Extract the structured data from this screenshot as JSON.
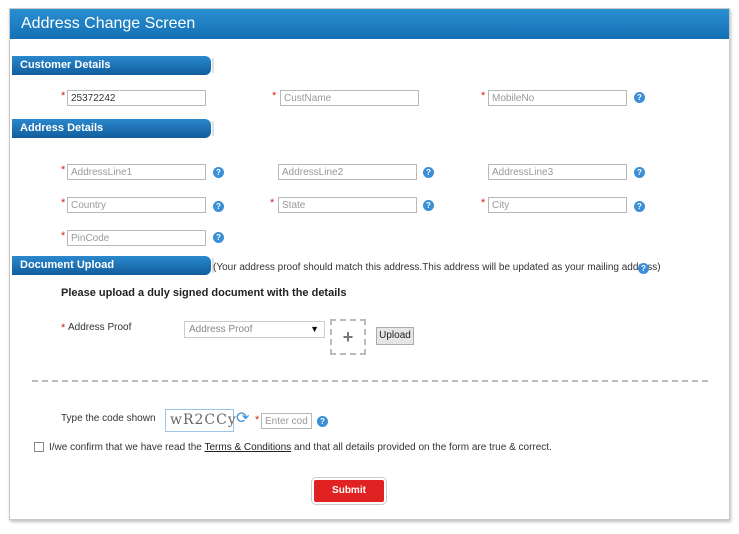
{
  "title": "Address Change Screen",
  "sections": {
    "customer": "Customer Details",
    "address": "Address Details",
    "upload": "Document Upload"
  },
  "customer": {
    "account_value": "25372242",
    "cust_name_placeholder": "CustName",
    "mobile_placeholder": "MobileNo"
  },
  "address": {
    "line1_placeholder": "AddressLine1",
    "line2_placeholder": "AddressLine2",
    "line3_placeholder": "AddressLine3",
    "country_placeholder": "Country",
    "state_placeholder": "State",
    "city_placeholder": "City",
    "pincode_placeholder": "PinCode"
  },
  "required_mark": "*",
  "help_glyph": "?",
  "upload": {
    "note": "(Your address proof should match this address.This address will be updated as your mailing address)",
    "instruction": "Please upload a duly signed document with the details",
    "proof_label": "Address Proof",
    "proof_selected": "Address Proof",
    "caret": "▼",
    "plus": "+",
    "upload_button": "Upload"
  },
  "captcha": {
    "label": "Type the code shown",
    "code": "wR2CCy",
    "refresh": "⟳",
    "placeholder": "Enter code"
  },
  "confirm": {
    "prefix": "I/we confirm that we have read the ",
    "link": "Terms & Conditions",
    "suffix": " and that all details provided on the form are true & correct."
  },
  "submit": "Submit",
  "colors": {
    "header_blue": "#1470b4",
    "required_red": "#d62020",
    "submit_red": "#e02222",
    "help_blue": "#3b8fd6"
  }
}
